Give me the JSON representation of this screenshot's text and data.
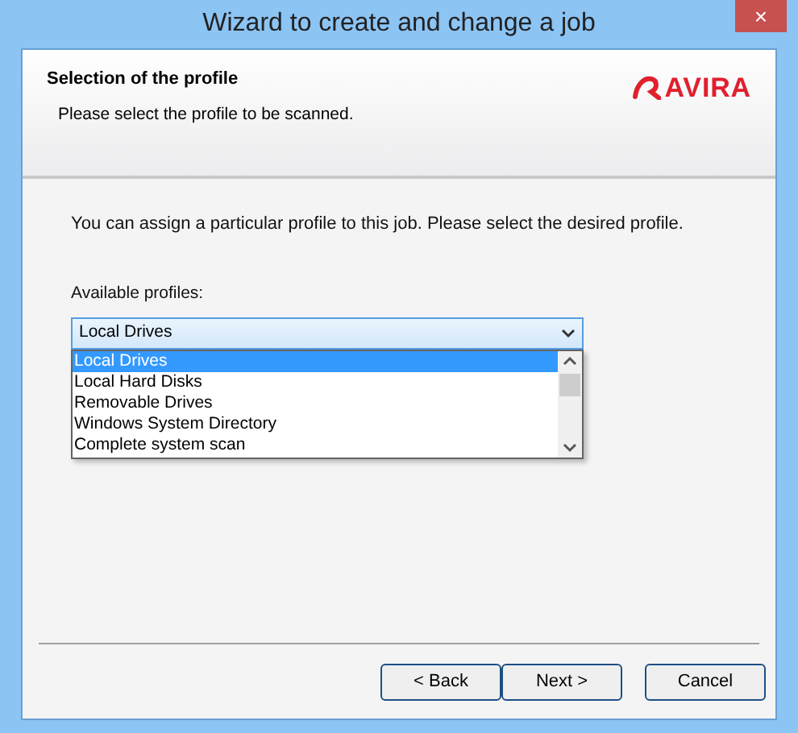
{
  "window": {
    "title": "Wizard to create and change a job",
    "close_button": "×"
  },
  "header": {
    "title": "Selection of the profile",
    "subtitle": "Please select the profile to be scanned.",
    "logo": "AVIRA"
  },
  "body": {
    "intro": "You can assign a particular profile to this job. Please select the desired profile.",
    "profiles_label": "Available profiles:",
    "dropdown": {
      "value": "Local Drives",
      "expanded": true,
      "options": [
        {
          "label": "Local Drives",
          "selected": true
        },
        {
          "label": "Local Hard Disks",
          "selected": false
        },
        {
          "label": "Removable Drives",
          "selected": false
        },
        {
          "label": "Windows System Directory",
          "selected": false
        },
        {
          "label": "Complete system scan",
          "selected": false
        }
      ]
    }
  },
  "buttons": [
    {
      "label": "< Back"
    },
    {
      "label": "Next >"
    },
    {
      "label": "Cancel"
    }
  ]
}
